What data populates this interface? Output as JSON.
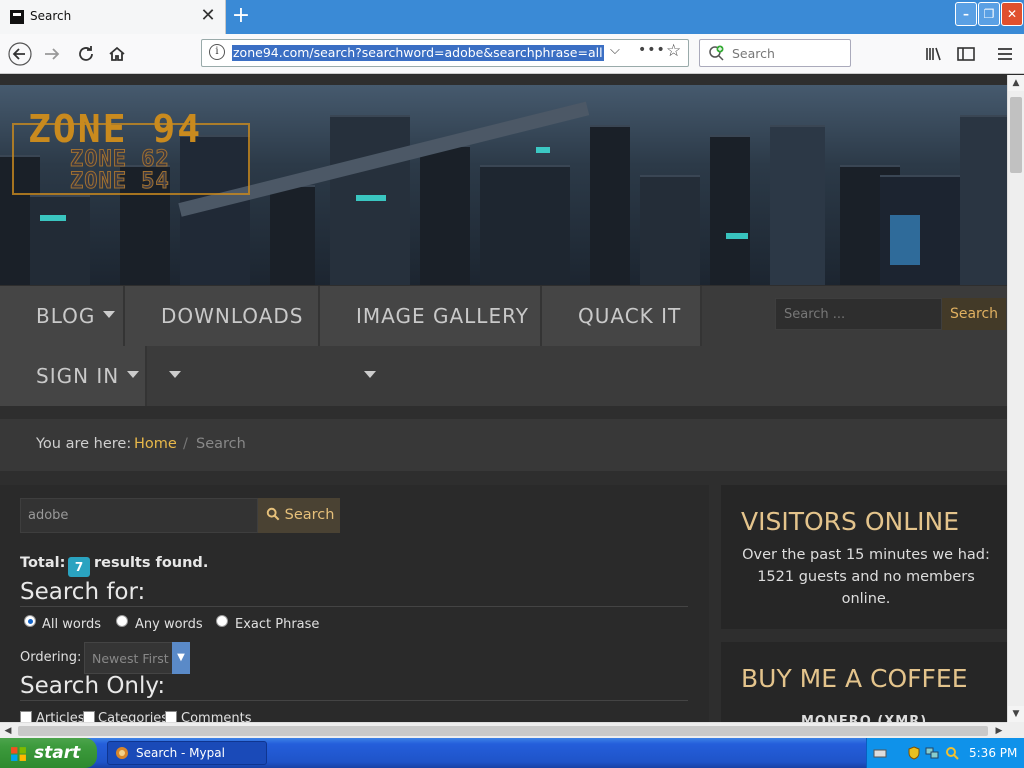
{
  "browser": {
    "tab_title": "Search",
    "close_tab_glyph": "✕",
    "new_tab_glyph": "+",
    "url": "zone94.com/search?searchword=adobe&searchphrase=all",
    "search_placeholder": "Search",
    "window_buttons": {
      "minimize": "–",
      "maximize": "❐",
      "close": "✕"
    }
  },
  "site": {
    "logo_main": "ZONE 94",
    "logo_sub1": "ZONE 62",
    "logo_sub2": "ZONE 54",
    "menu": [
      {
        "label": "BLOG",
        "has_dropdown": true
      },
      {
        "label": "DOWNLOADS",
        "has_dropdown": true
      },
      {
        "label": "IMAGE GALLERY",
        "has_dropdown": true
      },
      {
        "label": "QUACK IT",
        "has_dropdown": false
      },
      {
        "label": "SIGN IN",
        "has_dropdown": true
      }
    ],
    "top_search_placeholder": "Search ...",
    "top_search_button": "Search"
  },
  "breadcrumb": {
    "prefix": "You are here:",
    "home": "Home",
    "separator": "/",
    "current": "Search"
  },
  "search": {
    "query": "adobe",
    "button": "Search",
    "total_label": "Total:",
    "total_count": "7",
    "total_suffix": "results found.",
    "search_for_heading": "Search for:",
    "options": [
      {
        "label": "All words",
        "selected": true
      },
      {
        "label": "Any words",
        "selected": false
      },
      {
        "label": "Exact Phrase",
        "selected": false
      }
    ],
    "ordering_label": "Ordering:",
    "ordering_value": "Newest First",
    "search_only_heading": "Search Only:",
    "search_only": [
      "Articles",
      "Categories",
      "Comments"
    ]
  },
  "sidebar": {
    "visitors_title": "VISITORS ONLINE",
    "visitors_text": "Over the past 15 minutes we had: 1521 guests and no members online.",
    "coffee_title": "BUY ME A COFFEE",
    "coffee_sub": "MONERO (XMR)"
  },
  "taskbar": {
    "start": "start",
    "task": "Search - Mypal",
    "clock": "5:36 PM"
  },
  "colors": {
    "accent": "#e8b84a",
    "badge": "#2aa3c0",
    "xp_blue": "#245edb",
    "xp_green": "#3c9a3c"
  }
}
